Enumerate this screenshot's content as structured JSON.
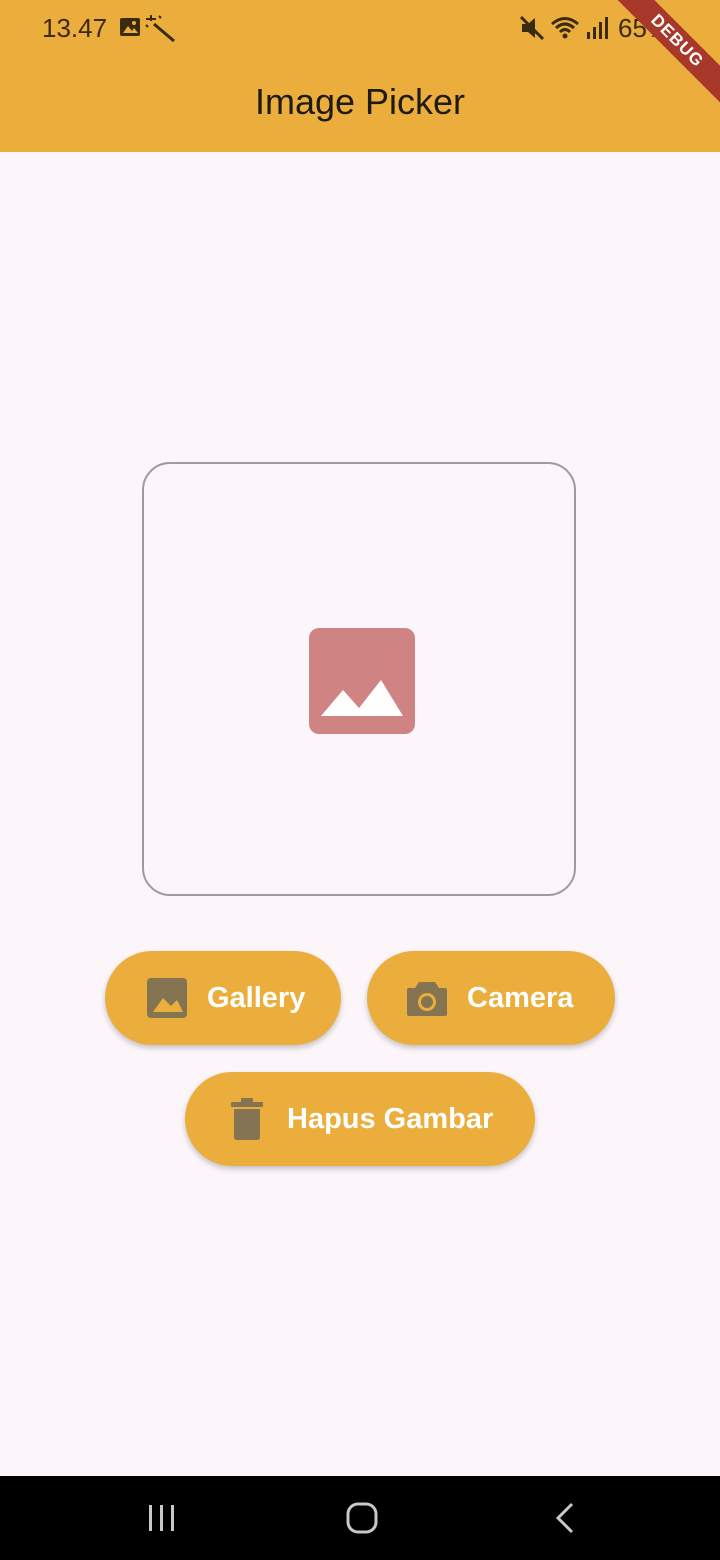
{
  "status_bar": {
    "time": "13.47",
    "battery": "65%",
    "icons": [
      "image-icon",
      "magic-wand-icon",
      "mute-icon",
      "wifi-icon",
      "signal-icon",
      "battery-icon"
    ]
  },
  "debug_banner": "DEBUG",
  "app_bar": {
    "title": "Image Picker",
    "color": "#ebae3c"
  },
  "preview": {
    "placeholder_icon": "image-placeholder-icon",
    "placeholder_color": "#d08383"
  },
  "buttons": {
    "gallery": {
      "label": "Gallery",
      "icon": "image-icon"
    },
    "camera": {
      "label": "Camera",
      "icon": "camera-icon"
    },
    "delete": {
      "label": "Hapus Gambar",
      "icon": "trash-icon"
    },
    "background": "#ebae3c",
    "icon_color": "#857452"
  },
  "nav_bar": {
    "items": [
      "recent-apps-icon",
      "home-icon",
      "back-icon"
    ]
  }
}
